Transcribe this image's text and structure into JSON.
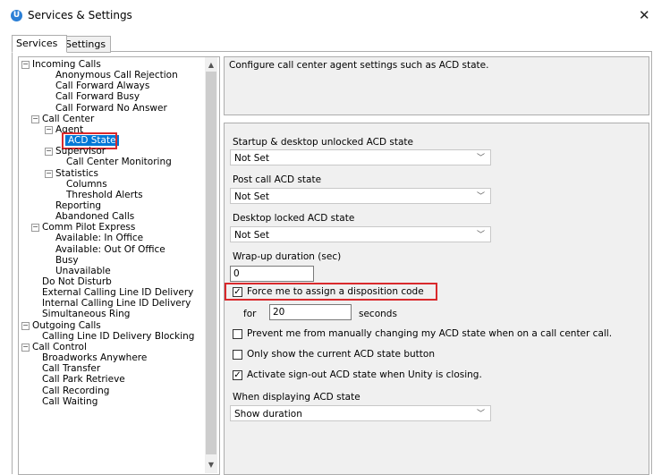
{
  "window": {
    "title": "Services & Settings",
    "close_glyph": "✕",
    "app_icon": "unity-icon",
    "app_letter": "U"
  },
  "tabs": [
    {
      "label": "Services"
    },
    {
      "label": "Settings"
    }
  ],
  "tree": {
    "items": [
      {
        "label": "Incoming Calls",
        "level": 0,
        "exp": "−"
      },
      {
        "label": "Anonymous Call Rejection",
        "level": 2
      },
      {
        "label": "Call Forward Always",
        "level": 2
      },
      {
        "label": "Call Forward Busy",
        "level": 2
      },
      {
        "label": "Call Forward No Answer",
        "level": 2
      },
      {
        "label": "Call Center",
        "level": 1,
        "exp": "−"
      },
      {
        "label": "Agent",
        "level": 2,
        "exp": "−"
      },
      {
        "label": "ACD State",
        "level": 3,
        "selected": true
      },
      {
        "label": "Supervisor",
        "level": 2,
        "exp": "−"
      },
      {
        "label": "Call Center Monitoring",
        "level": 3
      },
      {
        "label": "Statistics",
        "level": 2,
        "exp": "−"
      },
      {
        "label": "Columns",
        "level": 3
      },
      {
        "label": "Threshold Alerts",
        "level": 3
      },
      {
        "label": "Reporting",
        "level": 2
      },
      {
        "label": "Abandoned Calls",
        "level": 2
      },
      {
        "label": "Comm Pilot Express",
        "level": 1,
        "exp": "−"
      },
      {
        "label": "Available: In Office",
        "level": 2
      },
      {
        "label": "Available: Out Of Office",
        "level": 2
      },
      {
        "label": "Busy",
        "level": 2
      },
      {
        "label": "Unavailable",
        "level": 2
      },
      {
        "label": "Do Not Disturb",
        "level": 1
      },
      {
        "label": "External Calling Line ID Delivery",
        "level": 1
      },
      {
        "label": "Internal Calling Line ID Delivery",
        "level": 1
      },
      {
        "label": "Simultaneous Ring",
        "level": 1
      },
      {
        "label": "Outgoing Calls",
        "level": 0,
        "exp": "−"
      },
      {
        "label": "Calling Line ID Delivery Blocking",
        "level": 1
      },
      {
        "label": "Call Control",
        "level": 0,
        "exp": "−"
      },
      {
        "label": "Broadworks Anywhere",
        "level": 1
      },
      {
        "label": "Call Transfer",
        "level": 1
      },
      {
        "label": "Call Park Retrieve",
        "level": 1
      },
      {
        "label": "Call Recording",
        "level": 1
      },
      {
        "label": "Call Waiting",
        "level": 1
      }
    ]
  },
  "description": "Configure call center agent settings such as ACD state.",
  "settings": {
    "startup_label": "Startup & desktop unlocked ACD state",
    "startup_value": "Not Set",
    "post_call_label": "Post call ACD state",
    "post_call_value": "Not Set",
    "locked_label": "Desktop locked ACD state",
    "locked_value": "Not Set",
    "wrapup_label": "Wrap-up duration (sec)",
    "wrapup_value": "0",
    "force_label": "Force me to assign a disposition code",
    "force_checked": true,
    "for_label": "for",
    "for_value": "20",
    "seconds_label": "seconds",
    "prevent_label": "Prevent me from manually changing my ACD state when on a call center call.",
    "prevent_checked": false,
    "only_show_label": "Only show the current ACD state button",
    "only_show_checked": false,
    "activate_label": "Activate sign-out ACD state when Unity is closing.",
    "activate_checked": true,
    "display_label": "When displaying ACD state",
    "display_value": "Show duration"
  },
  "colors": {
    "highlight": "#d9292c",
    "selection": "#0078d7",
    "panel": "#f0f0f0"
  }
}
